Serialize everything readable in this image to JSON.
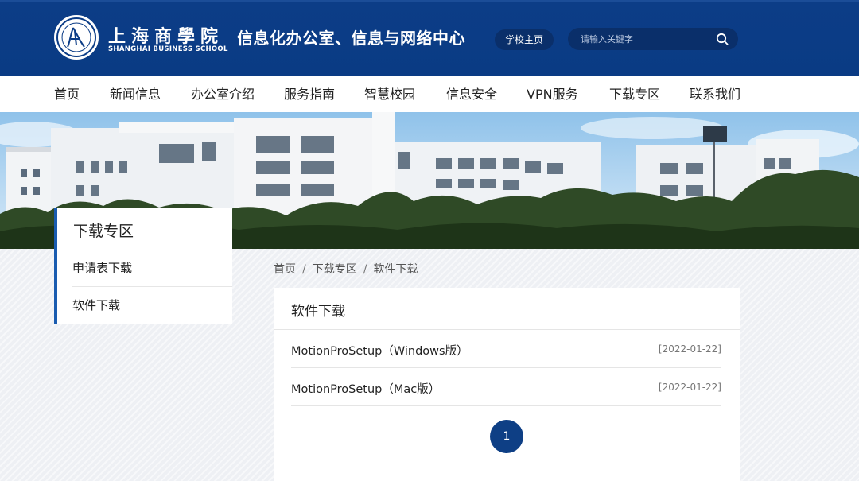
{
  "header": {
    "school_name_cn": "上海商學院",
    "school_name_en": "SHANGHAI BUSINESS SCHOOL",
    "office_title": "信息化办公室、信息与网络中心",
    "home_button": "学校主页",
    "search_placeholder": "请输入关键字",
    "search_icon": "search-icon",
    "brand_color": "#0b3c86"
  },
  "nav": {
    "items": [
      {
        "label": "首页"
      },
      {
        "label": "新闻信息"
      },
      {
        "label": "办公室介绍"
      },
      {
        "label": "服务指南"
      },
      {
        "label": "智慧校园"
      },
      {
        "label": "信息安全"
      },
      {
        "label": "VPN服务"
      },
      {
        "label": "下载专区"
      },
      {
        "label": "联系我们"
      }
    ]
  },
  "sidebar": {
    "title": "下载专区",
    "items": [
      {
        "label": "申请表下载"
      },
      {
        "label": "软件下载"
      }
    ]
  },
  "breadcrumb": {
    "items": [
      "首页",
      "下载专区",
      "软件下载"
    ],
    "separator": "/"
  },
  "content": {
    "title": "软件下载",
    "rows": [
      {
        "title": "MotionProSetup（Windows版）",
        "date": "[2022-01-22]"
      },
      {
        "title": "MotionProSetup（Mac版）",
        "date": "[2022-01-22]"
      }
    ],
    "pagination": {
      "current_page": "1"
    }
  }
}
